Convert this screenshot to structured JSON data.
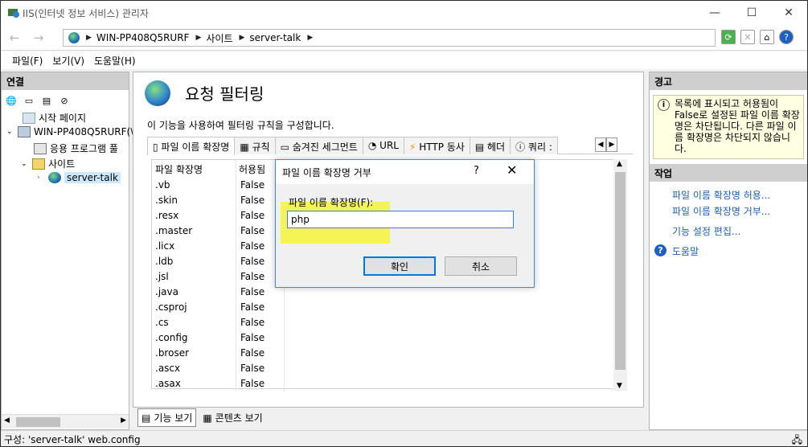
{
  "window": {
    "title": "IIS(인터넷 정보 서비스) 관리자",
    "controls": [
      "—",
      "☐",
      "✕"
    ]
  },
  "address": {
    "crumbs": [
      "WIN-PP408Q5RURF",
      "사이트",
      "server-talk"
    ]
  },
  "menu": [
    "파일(F)",
    "보기(V)",
    "도움말(H)"
  ],
  "connections": {
    "header": "연결",
    "tree": [
      "시작 페이지",
      "WIN-PP408Q5RURF(\\",
      "응용 프로그램 풀",
      "사이트",
      "server-talk"
    ]
  },
  "main": {
    "title": "요청 필터링",
    "description": "이 기능을 사용하여 필터링 규칙을 구성합니다.",
    "tabs": [
      "파일 이름 확장명",
      "규칙",
      "숨겨진 세그먼트",
      "URL",
      "HTTP 동사",
      "헤더",
      "쿼리 :"
    ],
    "columns": [
      "파일 확장명",
      "허용됨"
    ],
    "rows": [
      [
        ".vb",
        "False"
      ],
      [
        ".skin",
        "False"
      ],
      [
        ".resx",
        "False"
      ],
      [
        ".master",
        "False"
      ],
      [
        ".licx",
        "False"
      ],
      [
        ".ldb",
        "False"
      ],
      [
        ".jsl",
        "False"
      ],
      [
        ".java",
        "False"
      ],
      [
        ".csproj",
        "False"
      ],
      [
        ".cs",
        "False"
      ],
      [
        ".config",
        "False"
      ],
      [
        ".broser",
        "False"
      ],
      [
        ".ascx",
        "False"
      ],
      [
        ".asax",
        "False"
      ]
    ],
    "bottom_tabs": [
      "기능 보기",
      "콘텐츠 보기"
    ]
  },
  "actions": {
    "alert_header": "경고",
    "alert_text": "목록에 표시되고 허용됨이 False로 설정된 파일 이름 확장명은 차단됩니다. 다른 파일 이름 확장명은 차단되지 않습니다.",
    "work_header": "작업",
    "links": [
      "파일 이름 확장명 허용...",
      "파일 이름 확장명 거부...",
      "기능 설정 편집...",
      "도움말"
    ]
  },
  "status": {
    "text": "구성: 'server-talk' web.config"
  },
  "dialog": {
    "title": "파일 이름 확장명 거부",
    "help": "?",
    "close": "✕",
    "label": "파일 이름 확장명(F):",
    "value": "php",
    "ok": "확인",
    "cancel": "취소"
  }
}
